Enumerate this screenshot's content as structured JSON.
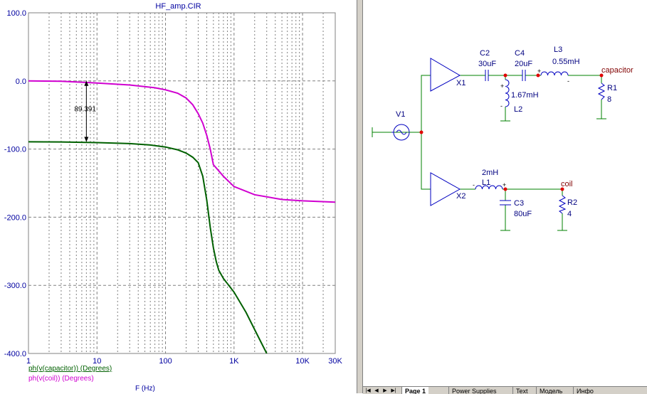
{
  "plot": {
    "title": "HF_amp.CIR",
    "x_axis_label": "F (Hz)",
    "marker_readout": "89.391",
    "legend": [
      {
        "label": "ph(v(capacitor)) (Degrees)",
        "color": "#006000"
      },
      {
        "label": "ph(v(coil)) (Degrees)",
        "color": "#d000d0"
      }
    ]
  },
  "chart_data": {
    "type": "line",
    "xscale": "log",
    "xlim": [
      1,
      30000
    ],
    "ylim": [
      -400,
      100
    ],
    "ylabel": "",
    "xlabel": "F (Hz)",
    "ytick_labels": [
      "100.0",
      "0.0",
      "-100.0",
      "-200.0",
      "-300.0",
      "-400.0"
    ],
    "ytick_values": [
      100,
      0,
      -100,
      -200,
      -300,
      -400
    ],
    "xtick_labels": [
      "1",
      "10",
      "100",
      "1K",
      "10K",
      "30K"
    ],
    "xtick_values": [
      1,
      10,
      100,
      1000,
      10000,
      30000
    ],
    "grid": true,
    "series": [
      {
        "name": "ph(v(coil)) (Degrees)",
        "color": "#d000d0",
        "x": [
          1,
          3,
          10,
          30,
          70,
          100,
          150,
          200,
          250,
          300,
          350,
          400,
          450,
          500,
          600,
          700,
          1000,
          2000,
          5000,
          10000,
          30000
        ],
        "y": [
          0,
          -0.5,
          -3,
          -6,
          -10,
          -13,
          -18,
          -25,
          -35,
          -48,
          -62,
          -80,
          -100,
          -123,
          -132,
          -140,
          -155,
          -167,
          -174,
          -176,
          -178
        ]
      },
      {
        "name": "ph(v(capacitor)) (Degrees)",
        "color": "#006000",
        "x": [
          1,
          3,
          10,
          30,
          60,
          100,
          150,
          200,
          250,
          300,
          350,
          400,
          450,
          500,
          550,
          600,
          700,
          1000,
          1500,
          2000,
          3000
        ],
        "y": [
          -89.4,
          -89.6,
          -90.5,
          -92,
          -94,
          -97,
          -101,
          -106,
          -112,
          -120,
          -140,
          -175,
          -215,
          -245,
          -265,
          -278,
          -290,
          -310,
          -340,
          -365,
          -400
        ]
      }
    ]
  },
  "schematic": {
    "components": {
      "c2": {
        "name": "C2",
        "value": "30uF"
      },
      "c4": {
        "name": "C4",
        "value": "20uF"
      },
      "l3": {
        "name": "L3",
        "value": "0.55mH"
      },
      "l2": {
        "name": "L2",
        "value": "1.67mH"
      },
      "r1": {
        "name": "R1",
        "value": "8"
      },
      "v1": {
        "name": "V1"
      },
      "x1": {
        "name": "X1"
      },
      "x2": {
        "name": "X2"
      },
      "l1": {
        "name": "L1",
        "value": "2mH"
      },
      "c3": {
        "name": "C3",
        "value": "80uF"
      },
      "r2": {
        "name": "R2",
        "value": "4"
      }
    },
    "nodes": {
      "capacitor": "capacitor",
      "coil": "coil"
    }
  },
  "tabs": {
    "nav": [
      "|◀",
      "◀",
      "▶",
      "▶|"
    ],
    "items": [
      "Page 1",
      "Power Supplies",
      "Text",
      "Модель",
      "Инфо"
    ]
  },
  "colors": {
    "axis_label": "#0000a0",
    "grid": "#808080",
    "wire": "#008000",
    "component": "#0000c0",
    "node_dot": "#e00000",
    "node_label": "#800000"
  }
}
